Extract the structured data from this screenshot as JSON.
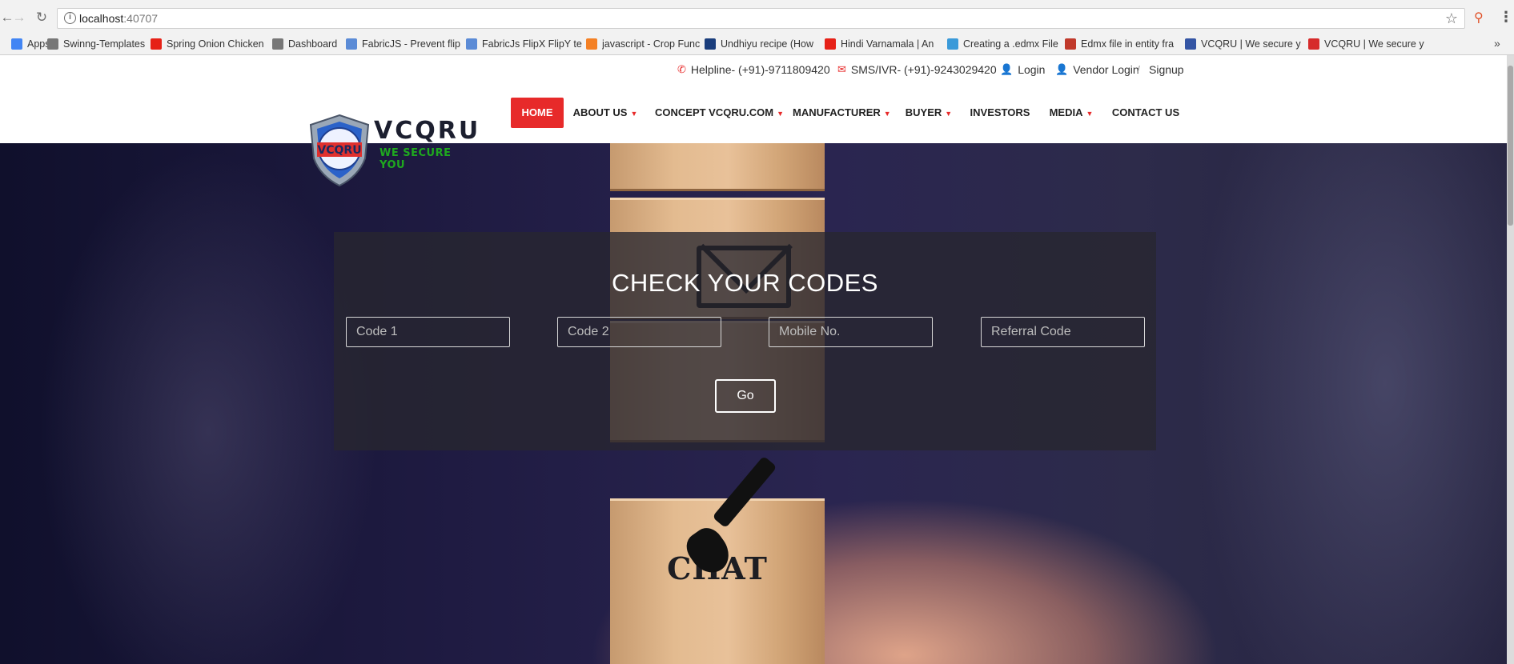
{
  "browser": {
    "url_host": "localhost",
    "url_port": ":40707",
    "bookmarks": [
      {
        "label": "Apps",
        "icon": "apps-grid-icon",
        "color": "#4285f4"
      },
      {
        "label": "Swinng-Templates",
        "icon": "page-icon",
        "color": "#777777"
      },
      {
        "label": "Spring Onion Chicken",
        "icon": "youtube-icon",
        "color": "#e62117"
      },
      {
        "label": "Dashboard",
        "icon": "page-icon",
        "color": "#777777"
      },
      {
        "label": "FabricJS - Prevent flip",
        "icon": "cloud-icon",
        "color": "#5b8bd6"
      },
      {
        "label": "FabricJs FlipX FlipY te",
        "icon": "cloud-icon",
        "color": "#5b8bd6"
      },
      {
        "label": "javascript - Crop Func",
        "icon": "stackoverflow-icon",
        "color": "#f48024"
      },
      {
        "label": "Undhiyu recipe (How",
        "icon": "grid-icon",
        "color": "#1a3d7c"
      },
      {
        "label": "Hindi Varnamala | An",
        "icon": "youtube-icon",
        "color": "#e62117"
      },
      {
        "label": "Creating a .edmx File",
        "icon": "bookmark-icon",
        "color": "#3a9ad9"
      },
      {
        "label": "Edmx file in entity fra",
        "icon": "curve-icon",
        "color": "#c0392b"
      },
      {
        "label": "VCQRU | We secure y",
        "icon": "vcqru-icon",
        "color": "#3455a4"
      },
      {
        "label": "VCQRU | We secure y",
        "icon": "bars-icon",
        "color": "#d62b2b"
      }
    ]
  },
  "site": {
    "helpline": "Helpline- (+91)-9711809420",
    "sms": "SMS/IVR- (+91)-9243029420",
    "login": "Login",
    "vendor_login": "Vendor Login",
    "separator": "/",
    "signup": "Signup",
    "logo_name": "VCQRU",
    "logo_tagline": "WE SECURE YOU",
    "nav": [
      "HOME",
      "ABOUT US",
      "CONCEPT VCQRU.COM",
      "MANUFACTURER",
      "BUYER",
      "INVESTORS",
      "MEDIA",
      "CONTACT US"
    ],
    "nav_dropdown": [
      false,
      true,
      true,
      true,
      true,
      false,
      true,
      false
    ],
    "accent_color": "#e72a2a"
  },
  "hero": {
    "block_text": "CHAT"
  },
  "check_panel": {
    "title": "CHECK YOUR CODES",
    "code1_placeholder": "Code 1",
    "code2_placeholder": "Code 2",
    "mobile_placeholder": "Mobile No.",
    "referral_placeholder": "Referral Code",
    "go_label": "Go"
  }
}
